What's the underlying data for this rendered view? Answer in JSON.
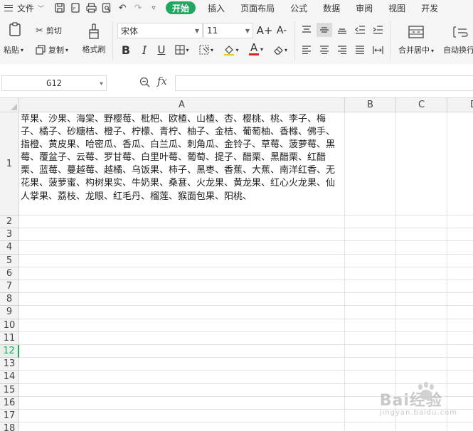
{
  "menu": {
    "file_label": "文件",
    "tabs": [
      "开始",
      "插入",
      "页面布局",
      "公式",
      "数据",
      "审阅",
      "视图",
      "开发"
    ],
    "active_tab": "开始"
  },
  "ribbon": {
    "paste_label": "粘贴",
    "cut_label": "剪切",
    "copy_label": "复制",
    "format_painter_label": "格式刷",
    "font_name": "宋体",
    "font_size": "11",
    "increase_font": "A+",
    "decrease_font": "A-",
    "bold": "B",
    "italic": "I",
    "underline": "U",
    "font_color_letter": "A",
    "merge_center_label": "合并居中",
    "auto_wrap_label": "自动换行"
  },
  "formula_bar": {
    "cell_ref": "G12",
    "fx": "fx",
    "formula": ""
  },
  "grid": {
    "columns": [
      "A",
      "B",
      "C",
      "D"
    ],
    "rows": [
      "1",
      "2",
      "3",
      "4",
      "5",
      "6",
      "7",
      "8",
      "9",
      "10",
      "11",
      "12",
      "13",
      "14",
      "15",
      "16",
      "17",
      "18"
    ],
    "selected_row": "12",
    "cell_A1": "苹果、沙果、海棠、野樱莓、枇杷、欧楂、山楂、杏、樱桃、桃、李子、梅子、橘子、砂糖桔、橙子、柠檬、青柠、柚子、金桔、葡萄柚、香橼、佛手、指橙、黄皮果、哈密瓜、香瓜、白兰瓜、刺角瓜、金铃子、草莓、菠萝莓、黑莓、覆盆子、云莓、罗甘莓、白里叶莓、葡萄、提子、醋栗、黑醋栗、红醋栗、蓝莓、蔓越莓、越橘、乌饭果、柿子、黑枣、香蕉、大蕉、南洋红香、无花果、菠萝蜜、构树果实、牛奶果、桑葚、火龙果、黄龙果、红心火龙果、仙人掌果、荔枝、龙眼、红毛丹、榴莲、猴面包果、阳桃、"
  },
  "watermark": {
    "main": "Bai经验",
    "sub": "jingyan.baidu.com"
  },
  "colors": {
    "accent": "#1ea861",
    "font_color_bar": "#e02020"
  }
}
